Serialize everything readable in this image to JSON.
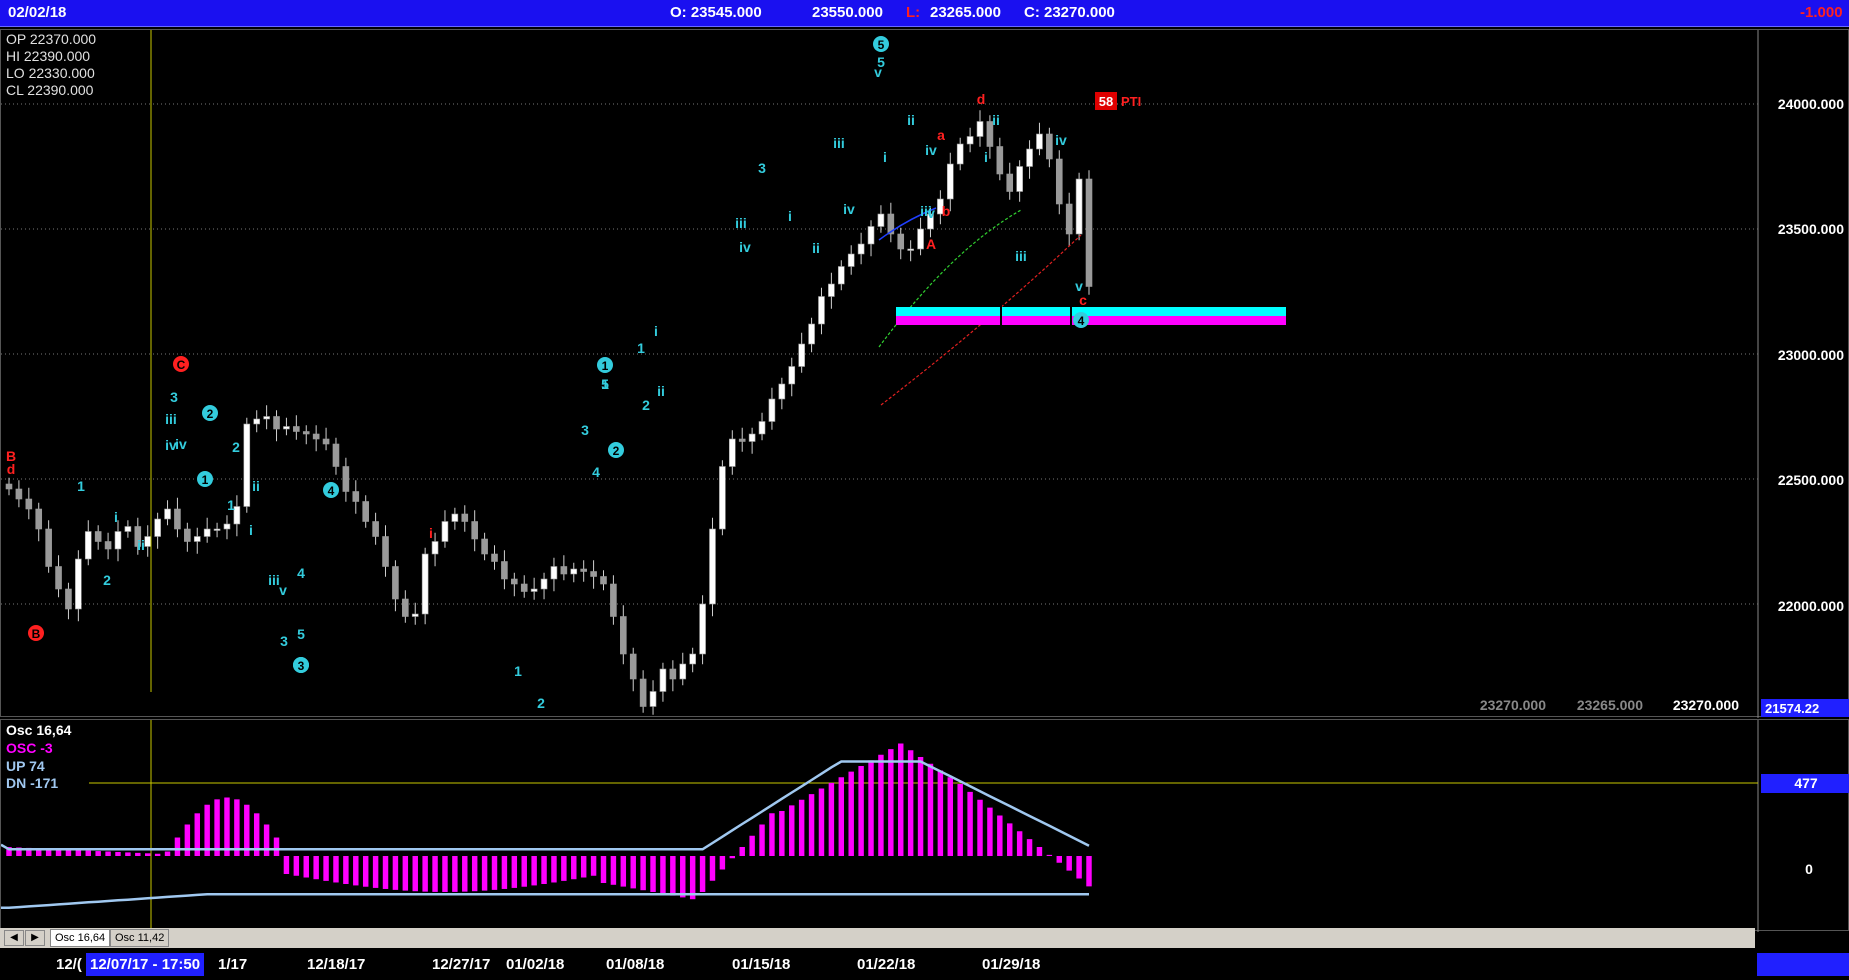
{
  "header": {
    "date": "02/02/18",
    "open": "O: 23545.000",
    "high": "23550.000",
    "low_label": "L:",
    "low": "23265.000",
    "close": "C: 23270.000",
    "change": "-1.000"
  },
  "info_box": [
    {
      "label": "OP",
      "value": "22370.000"
    },
    {
      "label": "HI",
      "value": "22390.000"
    },
    {
      "label": "LO",
      "value": "22330.000"
    },
    {
      "label": "CL",
      "value": "22390.000"
    }
  ],
  "main_axis": {
    "ticks": [
      "24000.000",
      "23500.000",
      "23000.000",
      "22500.000",
      "22000.000"
    ],
    "bottom_label": "21574.22",
    "footer_values": [
      "23270.000",
      "23265.000",
      "23270.000"
    ]
  },
  "pti": {
    "value": "58",
    "label": "PTI"
  },
  "osc_legend": [
    {
      "label": "Osc",
      "value": "16,64"
    },
    {
      "label": "OSC",
      "value": "-3"
    },
    {
      "label": "UP",
      "value": "74"
    },
    {
      "label": "DN",
      "value": "-171"
    }
  ],
  "osc_axis": {
    "marker": "477",
    "zero": "0"
  },
  "tabs": [
    "Osc 16,64",
    "Osc 11,42"
  ],
  "dates": [
    "12/07/17 - 17:50",
    "12/18/17",
    "12/27/17",
    "01/02/18",
    "01/08/18",
    "01/15/18",
    "01/22/18",
    "01/29/18"
  ],
  "date_fragments": [
    "12/(",
    "1/17"
  ],
  "chart_data": [
    {
      "type": "candlestick",
      "ylim": [
        21574.22,
        24300
      ],
      "x_count": 110,
      "close_series": [
        22460,
        22420,
        22380,
        22300,
        22150,
        22060,
        21980,
        22180,
        22290,
        22250,
        22220,
        22290,
        22310,
        22230,
        22270,
        22340,
        22380,
        22300,
        22250,
        22270,
        22300,
        22300,
        22320,
        22390,
        22720,
        22740,
        22750,
        22700,
        22710,
        22690,
        22680,
        22660,
        22640,
        22550,
        22450,
        22410,
        22330,
        22270,
        22150,
        22020,
        21950,
        21960,
        22200,
        22250,
        22330,
        22360,
        22330,
        22260,
        22200,
        22170,
        22100,
        22080,
        22050,
        22060,
        22100,
        22150,
        22120,
        22140,
        22130,
        22110,
        22080,
        21950,
        21800,
        21700,
        21590,
        21650,
        21740,
        21700,
        21760,
        21800,
        22000,
        22300,
        22550,
        22660,
        22650,
        22680,
        22730,
        22820,
        22880,
        22950,
        23040,
        23120,
        23230,
        23280,
        23350,
        23400,
        23440,
        23510,
        23560,
        23480,
        23420,
        23420,
        23500,
        23560,
        23620,
        23760,
        23840,
        23870,
        23930,
        23830,
        23720,
        23650,
        23750,
        23820,
        23880,
        23780,
        23600,
        23480,
        23700,
        23270
      ],
      "annotations": [
        "B",
        "d",
        "1",
        "i",
        "ii",
        "2",
        "iii",
        "iv",
        "3",
        "iv",
        "ii",
        "2",
        "1",
        "i",
        "iii",
        "v",
        "3",
        "5",
        "4",
        "i",
        "1",
        "2",
        "3",
        "4",
        "5",
        "1",
        "i",
        "ii",
        "2",
        "1",
        "3",
        "iii",
        "iv",
        "v",
        "i",
        "ii",
        "iii",
        "iv",
        "i",
        "ii",
        "iii",
        "iv",
        "v",
        "5",
        "a",
        "b",
        "A",
        "d",
        "ii",
        "i",
        "iii",
        "iv",
        "v",
        "c"
      ],
      "circled_annotations": [
        "B",
        "C",
        "1",
        "2",
        "3",
        "4",
        "5",
        "1",
        "2",
        "3",
        "4"
      ],
      "zone": {
        "top": 23180,
        "bottom": 23110,
        "colors": [
          "#00ffff",
          "#ff00ff"
        ]
      },
      "colors": {
        "candle": "#cfcfcf",
        "wave_up": "#33ccdd",
        "wave_down": "#ff2020"
      }
    },
    {
      "type": "bar",
      "name": "Osc 16,64",
      "ylim": [
        -230,
        560
      ],
      "histogram_color": "#ff00ff",
      "band_color": "#a0c8f0"
    }
  ]
}
